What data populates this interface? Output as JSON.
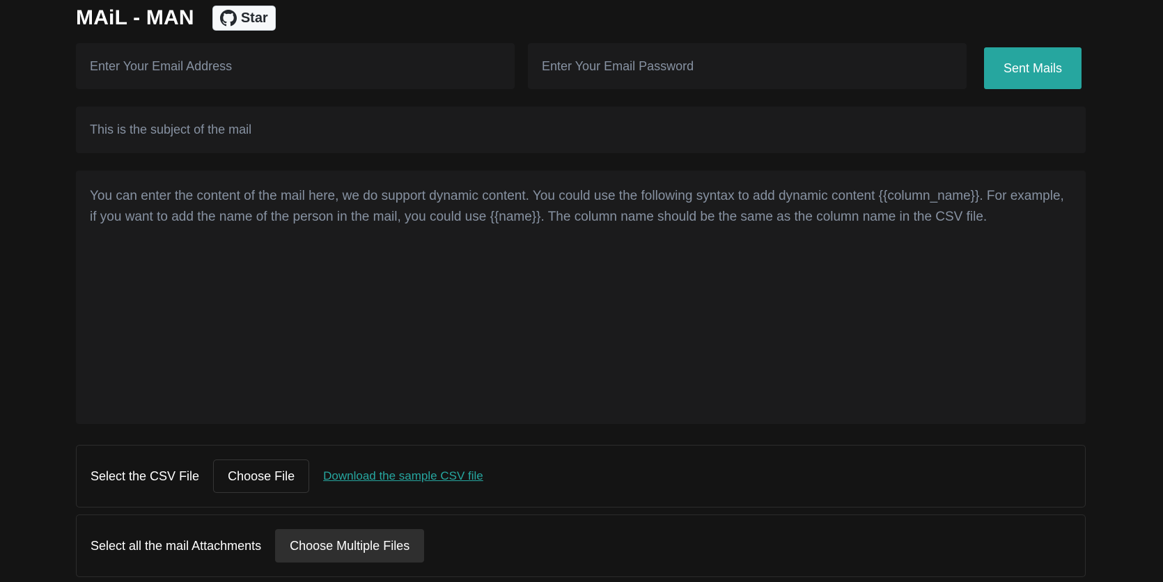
{
  "header": {
    "title": "MAiL - MAN",
    "star_label": "Star",
    "star_icon": "github-icon"
  },
  "form": {
    "email_placeholder": "Enter Your Email Address",
    "email_value": "",
    "password_placeholder": "Enter Your Email Password",
    "password_value": "",
    "send_label": "Sent Mails",
    "subject_placeholder": "This is the subject of the mail",
    "subject_value": "",
    "content_placeholder": "You can enter the content of the mail here, we do support dynamic content. You could use the following syntax to add dynamic content {{column_name}}. For example, if you want to add the name of the person in the mail, you could use {{name}}. The column name should be the same as the column name in the CSV file.",
    "content_value": ""
  },
  "csv": {
    "label": "Select the CSV File",
    "choose_label": "Choose File",
    "download_link": "Download the sample CSV file"
  },
  "attachments": {
    "label": "Select all the mail Attachments",
    "choose_label": "Choose Multiple Files"
  },
  "colors": {
    "background": "#141414",
    "field_background": "#1b1b1c",
    "accent": "#26a69f",
    "placeholder": "#8792a2"
  }
}
